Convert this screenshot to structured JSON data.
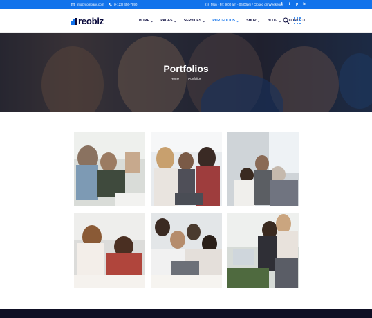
{
  "topbar": {
    "email": "info@company.com",
    "phone": "(+123) 456-7890",
    "hours": "Mon - Fri: 9:00 am - 06.00pm / Closed on Weekends",
    "social": [
      "f",
      "t",
      "p",
      "in"
    ]
  },
  "header": {
    "logo_text": "reobiz",
    "nav": [
      {
        "label": "HOME",
        "dropdown": true,
        "active": false
      },
      {
        "label": "PAGES",
        "dropdown": true,
        "active": false
      },
      {
        "label": "SERVICES",
        "dropdown": true,
        "active": false
      },
      {
        "label": "PORTFOLIOS",
        "dropdown": true,
        "active": true
      },
      {
        "label": "SHOP",
        "dropdown": true,
        "active": false
      },
      {
        "label": "BLOG",
        "dropdown": true,
        "active": false
      },
      {
        "label": "CONTACT",
        "dropdown": false,
        "active": false
      }
    ],
    "caret": "⌄"
  },
  "hero": {
    "title": "Portfolios",
    "breadcrumb": [
      "Home",
      "Portfolios"
    ]
  },
  "portfolio": {
    "items": [
      "portfolio-image-1",
      "portfolio-image-2",
      "portfolio-image-3",
      "portfolio-image-4",
      "portfolio-image-5",
      "portfolio-image-6"
    ]
  },
  "colors": {
    "accent": "#1273eb",
    "dark": "#0a0a3c",
    "footer": "#0f0f24"
  }
}
